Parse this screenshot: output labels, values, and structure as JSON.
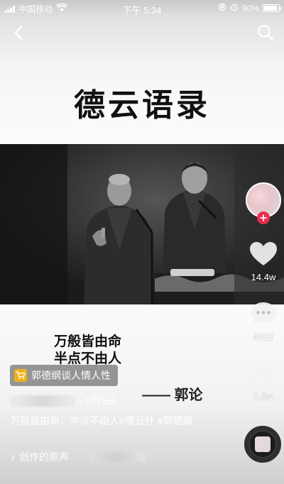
{
  "status_bar": {
    "carrier": "中国移动",
    "time": "下午 5:34",
    "battery": "90%",
    "battery_level": 0.9
  },
  "nav": {
    "back_icon": "chevron-left-icon",
    "search_icon": "search-icon"
  },
  "video": {
    "title": "德云语录",
    "quote_line_1": "万般皆由命",
    "quote_line_2": "半点不由人",
    "attribution": "—— 郭论"
  },
  "shop_tag": {
    "label": "郭德纲谈人情人性",
    "icon": "cart-icon",
    "accent": "#f2b21b"
  },
  "post": {
    "date": "· 5月5日",
    "caption": "万般皆由命，半点不由人#德云社 #郭德纲",
    "music_prefix": "♪",
    "music_label": "创作的原声"
  },
  "actions": {
    "likes": "14.4w",
    "comments": "4421",
    "shares": "1.5w",
    "follow_color": "#ee2a4f"
  }
}
